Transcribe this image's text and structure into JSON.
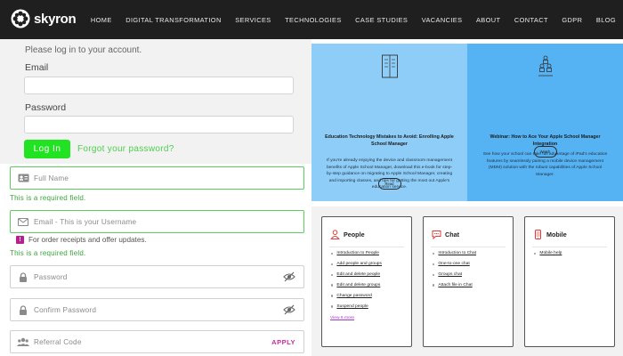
{
  "nav": {
    "logo_text": "skyron",
    "items": [
      "HOME",
      "DIGITAL TRANSFORMATION",
      "SERVICES",
      "TECHNOLOGIES",
      "CASE STUDIES",
      "VACANCIES",
      "ABOUT",
      "CONTACT",
      "GDPR",
      "BLOG"
    ]
  },
  "login": {
    "subtitle": "Please log in to your account.",
    "email_label": "Email",
    "email_value": "",
    "password_label": "Password",
    "password_value": "",
    "login_button": "Log In",
    "forgot_link": "Forgot your password?"
  },
  "register": {
    "full_name_placeholder": "Full Name",
    "full_name_error": "This is a required field.",
    "email_placeholder": "Email - This is your Username",
    "email_hint_badge": "!",
    "email_hint": "For order receipts and offer updates.",
    "email_error": "This is a required field.",
    "password_placeholder": "Password",
    "confirm_placeholder": "Confirm Password",
    "referral_placeholder": "Referral Code",
    "apply_label": "APPLY"
  },
  "banners": [
    {
      "title": "Education Technology Mistakes to Avoid: Enrolling Apple School Manager",
      "body": "If you're already enjoying the device and classroom management benefits of Apple School Manager, download this e-book for step-by-step guidance on migrating to Apple School Manager, creating and importing classes, and tips for getting the most out Apple's education service.",
      "button": "Read"
    },
    {
      "title": "Webinar: How to Ace Your Apple School Manager Integration",
      "body": "See how your school can take full advantage of iPad's education features by seamlessly pairing a mobile device management (MDM) solution with the robust capabilities of Apple School Manager.",
      "button": "Watch"
    }
  ],
  "cards": [
    {
      "title": "People",
      "links": [
        "Introduction to People",
        "Add people and groups",
        "Edit and delete people",
        "Edit and delete groups",
        "Change password",
        "Suspend people"
      ],
      "view_more": "View 6 more"
    },
    {
      "title": "Chat",
      "links": [
        "Introduction to Chat",
        "One-to-one chat",
        "Groups chat",
        "Attach file in Chat"
      ]
    },
    {
      "title": "Mobile",
      "links": [
        "Mobile help"
      ]
    }
  ],
  "colors": {
    "nav_bg": "#1f1f1f",
    "login_green": "#22e322",
    "valid_green": "#5ccc5c",
    "accent_magenta": "#c12b9c",
    "banner_light_blue": "#8ecdf8",
    "banner_blue": "#56b3f3",
    "card_icon_red": "#e23b3b"
  }
}
